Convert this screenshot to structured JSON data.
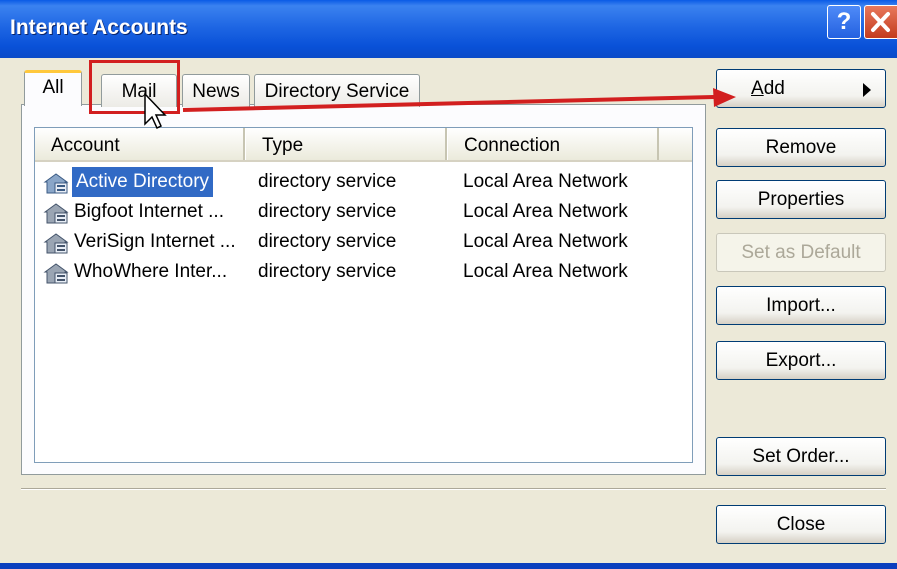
{
  "window": {
    "title": "Internet Accounts"
  },
  "titlebar": {
    "help_glyph": "?",
    "icons": {
      "help": "help-icon",
      "close": "close-icon"
    }
  },
  "tabs": [
    {
      "label": "All",
      "active": true
    },
    {
      "label": "Mail",
      "active": false
    },
    {
      "label": "News",
      "active": false
    },
    {
      "label": "Directory Service",
      "active": false
    }
  ],
  "list": {
    "columns": [
      "Account",
      "Type",
      "Connection"
    ],
    "rows": [
      {
        "account": "Active Directory",
        "type": "directory service",
        "connection": "Local Area Network",
        "selected": true,
        "icon": "directory-service-icon"
      },
      {
        "account": "Bigfoot Internet ...",
        "type": "directory service",
        "connection": "Local Area Network",
        "selected": false,
        "icon": "directory-service-icon"
      },
      {
        "account": "VeriSign Internet ...",
        "type": "directory service",
        "connection": "Local Area Network",
        "selected": false,
        "icon": "directory-service-icon"
      },
      {
        "account": "WhoWhere Inter...",
        "type": "directory service",
        "connection": "Local Area Network",
        "selected": false,
        "icon": "directory-service-icon"
      }
    ]
  },
  "buttons": {
    "add_prefix": "A",
    "add_rest": "dd",
    "remove": "Remove",
    "properties": "Properties",
    "set_default": "Set as Default",
    "import": "Import...",
    "export": "Export...",
    "set_order": "Set Order...",
    "close": "Close"
  },
  "colors": {
    "accent": "#D21F1F",
    "selection": "#316AC5",
    "titlebar": "#0A5BE6"
  }
}
